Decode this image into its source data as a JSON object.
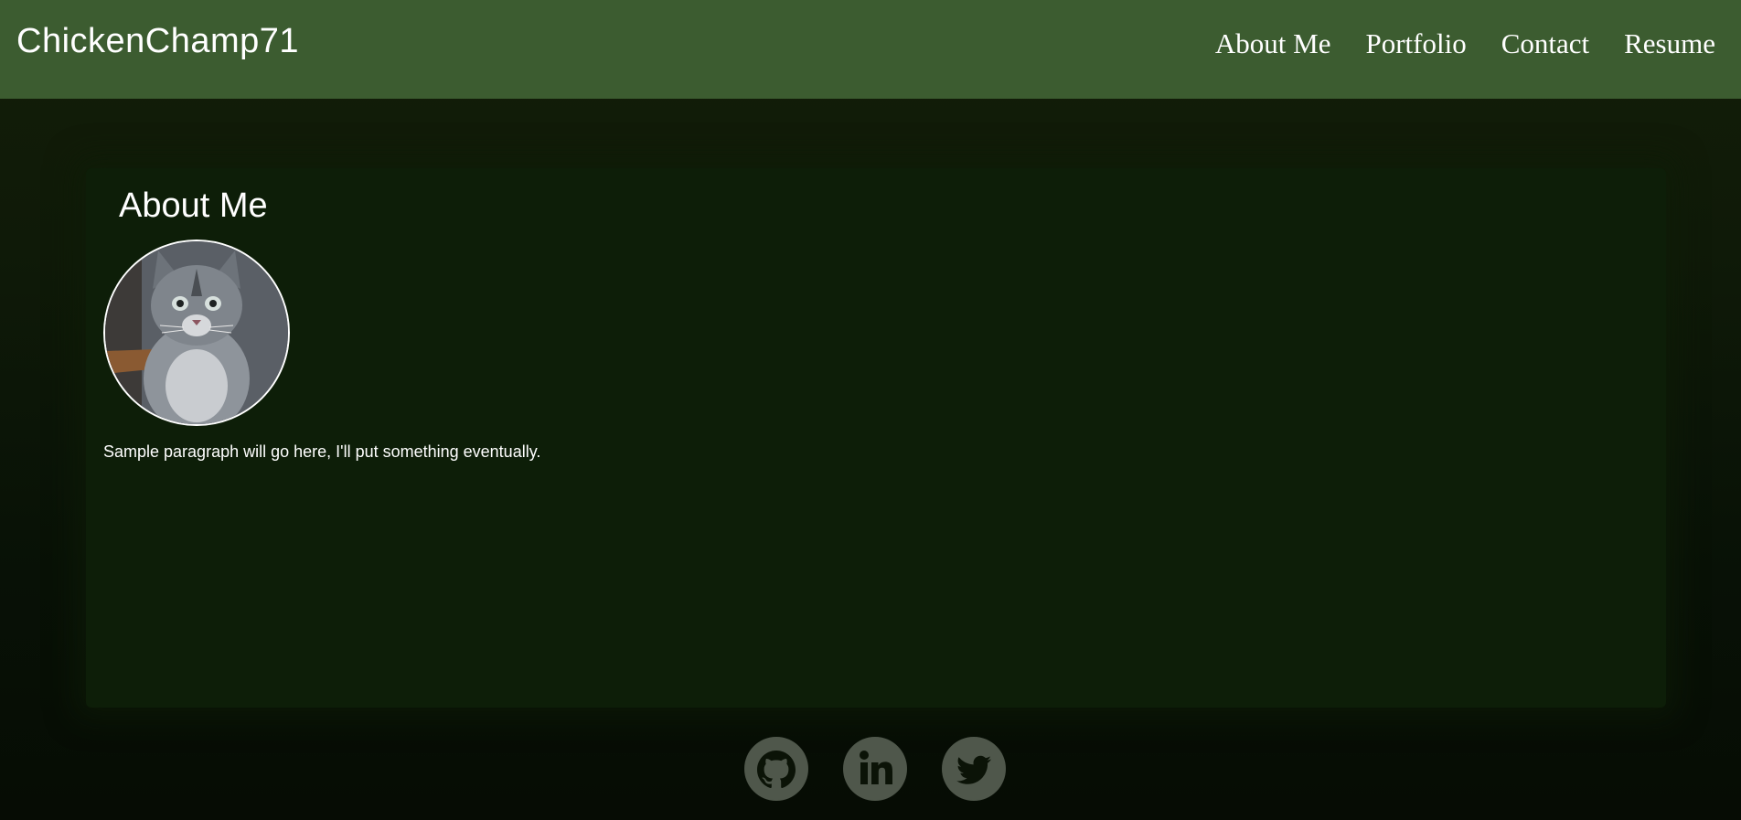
{
  "header": {
    "brand": "ChickenChamp71",
    "nav": [
      "About Me",
      "Portfolio",
      "Contact",
      "Resume"
    ]
  },
  "about": {
    "title": "About Me",
    "avatar_alt": "kitten-photo",
    "paragraph": "Sample paragraph will go here, I'll put something eventually."
  },
  "footer": {
    "social": [
      {
        "icon": "github-icon"
      },
      {
        "icon": "linkedin-icon"
      },
      {
        "icon": "twitter-icon"
      }
    ]
  },
  "colors": {
    "header_bg": "#3c5c30",
    "card_bg": "#0d1e08",
    "social_bg": "#4f574b",
    "text": "#ffffff"
  }
}
